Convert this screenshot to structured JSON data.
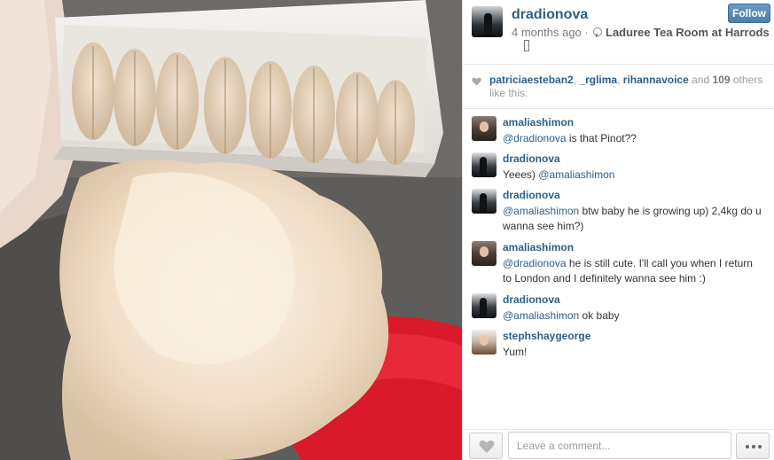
{
  "post": {
    "username": "dradionova",
    "time_ago": "4 months ago",
    "separator": "·",
    "location": "Laduree Tea Room at Harrods",
    "follow_label": "Follow"
  },
  "likes": {
    "user1": "patriciaesteban2",
    "sep1": ", ",
    "user2": "_rglima",
    "sep2": ", ",
    "user3": "rihannavoice",
    "and_text": " and ",
    "others_count": "109",
    "suffix": " others like this."
  },
  "comments": [
    {
      "user": "amaliashimon",
      "mention": "@dradionova",
      "text": " is that Pinot??"
    },
    {
      "user": "dradionova",
      "prefix": "Yeees) ",
      "mention": "@amaliashimon"
    },
    {
      "user": "dradionova",
      "mention": "@amaliashimon",
      "text": " btw baby he is growing up) 2,4kg do u wanna see him?)"
    },
    {
      "user": "amaliashimon",
      "mention": "@dradionova",
      "text": " he is still cute. I'll call you when I return to London and I definitely wanna see him :)"
    },
    {
      "user": "dradionova",
      "mention": "@amaliashimon",
      "text": " ok baby"
    },
    {
      "user": "stephshaygeorge",
      "text": "Yum!"
    }
  ],
  "footer": {
    "comment_placeholder": "Leave a comment..."
  },
  "colors": {
    "link": "#2e5e86",
    "follow_button": "#4a7fad"
  }
}
